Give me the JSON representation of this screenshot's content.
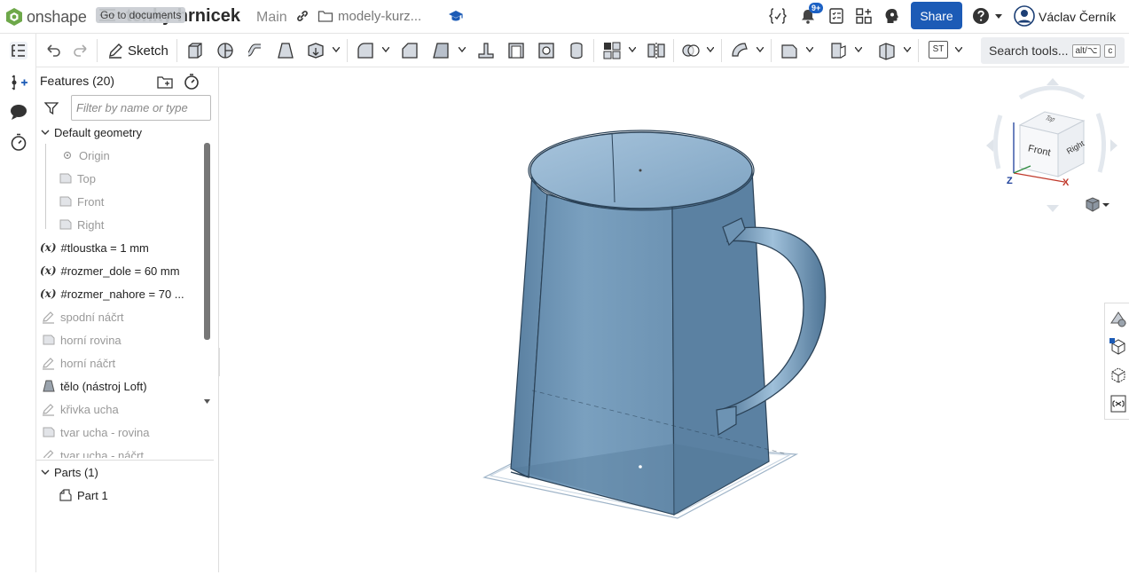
{
  "header": {
    "logo_text": "onshape",
    "tooltip": "Go to documents",
    "document_title": "tenky hrnicek",
    "branch": "Main",
    "folder": "modely-kurz...",
    "notifications_badge": "9+",
    "share_label": "Share",
    "user_name": "Václav Černík"
  },
  "toolbar": {
    "sketch_label": "Sketch",
    "search_label": "Search tools...",
    "search_shortcut_1": "alt/⌥",
    "search_shortcut_2": "c",
    "st_label": "ST"
  },
  "features": {
    "title": "Features (20)",
    "filter_placeholder": "Filter by name or type",
    "default_geometry_label": "Default geometry",
    "default_geometry": [
      "Origin",
      "Top",
      "Front",
      "Right"
    ],
    "variables": [
      {
        "symbol": "(x)",
        "label": "#tloustka = 1 mm"
      },
      {
        "symbol": "(x)",
        "label": "#rozmer_dole = 60 mm"
      },
      {
        "symbol": "(x)",
        "label": "#rozmer_nahore = 70 ..."
      }
    ],
    "items": [
      {
        "label": "spodní náčrt",
        "icon": "sketch-icon"
      },
      {
        "label": "horní rovina",
        "icon": "plane-icon"
      },
      {
        "label": "horní náčrt",
        "icon": "sketch-icon"
      },
      {
        "label": "tělo (nástroj Loft)",
        "icon": "loft-icon"
      },
      {
        "label": "křivka ucha",
        "icon": "sketch-icon"
      },
      {
        "label": "tvar ucha - rovina",
        "icon": "plane-icon"
      },
      {
        "label": "tvar ucha - náčrt",
        "icon": "sketch-icon"
      }
    ],
    "parts_label": "Parts (1)",
    "parts": [
      "Part 1"
    ]
  },
  "viewcube": {
    "faces": [
      "Top",
      "Front",
      "Right"
    ],
    "axes": [
      "Z",
      "X"
    ]
  },
  "colors": {
    "accent": "#1c5bb6",
    "model_fill": "#6f95b5",
    "model_dark": "#4f7596"
  }
}
